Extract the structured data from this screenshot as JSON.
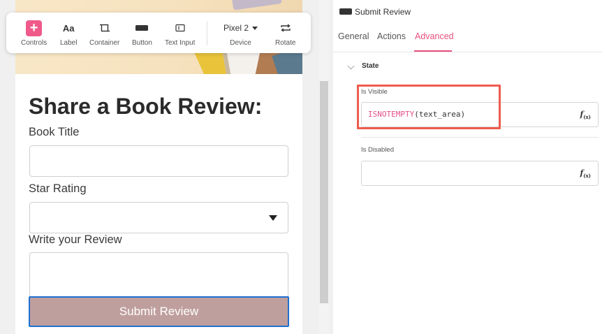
{
  "toolbar": {
    "tools": [
      {
        "label": "Controls",
        "icon": "plus-icon"
      },
      {
        "label": "Label",
        "icon": "text-aa-icon",
        "glyph": "Aa"
      },
      {
        "label": "Container",
        "icon": "container-icon"
      },
      {
        "label": "Button",
        "icon": "button-icon"
      },
      {
        "label": "Text Input",
        "icon": "text-input-icon"
      }
    ],
    "device": {
      "value": "Pixel 2",
      "label": "Device"
    },
    "rotate": {
      "label": "Rotate",
      "icon": "rotate-icon"
    }
  },
  "form": {
    "title": "Share a Book Review:",
    "book_title_label": "Book Title",
    "book_title_value": "",
    "star_rating_label": "Star Rating",
    "star_rating_value": "",
    "review_label": "Write your Review",
    "review_value": "",
    "submit_label": "Submit Review"
  },
  "panel": {
    "component_name": "Submit Review",
    "tabs": [
      {
        "label": "General",
        "active": false
      },
      {
        "label": "Actions",
        "active": false
      },
      {
        "label": "Advanced",
        "active": true
      }
    ],
    "section_title": "State",
    "is_visible": {
      "label": "Is Visible",
      "function": "ISNOTEMPTY",
      "args": "(text_area)"
    },
    "is_disabled": {
      "label": "Is Disabled",
      "value": ""
    },
    "fx_label": "f",
    "fx_sub": "(x)"
  },
  "colors": {
    "accent": "#e8507d",
    "highlight_border": "#ef5b4d",
    "submit_bg": "#bf9f9e",
    "focus_border": "#1f6fd1"
  }
}
